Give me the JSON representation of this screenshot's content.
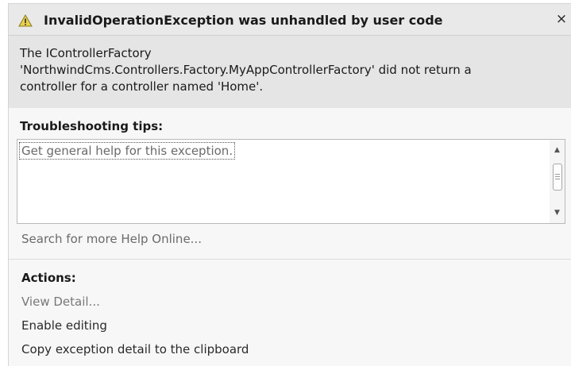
{
  "titlebar": {
    "icon": "warning-icon",
    "title": "InvalidOperationException was unhandled by user code",
    "close_label": "×"
  },
  "message": {
    "line1": "The IControllerFactory",
    "line2": "'NorthwindCms.Controllers.Factory.MyAppControllerFactory' did not return a",
    "line3": "controller for a controller named 'Home'."
  },
  "tips": {
    "heading": "Troubleshooting tips:",
    "items": [
      "Get general help for this exception."
    ]
  },
  "scrollbar": {
    "up_arrow": "▲",
    "down_arrow": "▼"
  },
  "search_link": "Search for more Help Online...",
  "actions": {
    "heading": "Actions:",
    "items": [
      "View Detail...",
      "Enable editing",
      "Copy exception detail to the clipboard"
    ]
  },
  "colors": {
    "titlebar_bg": "#e9e9e9",
    "message_bg": "#e5e5e5",
    "panel_bg": "#f7f7f7",
    "link_gray": "#6a6a6a",
    "warning_yellow": "#e8d24a"
  }
}
